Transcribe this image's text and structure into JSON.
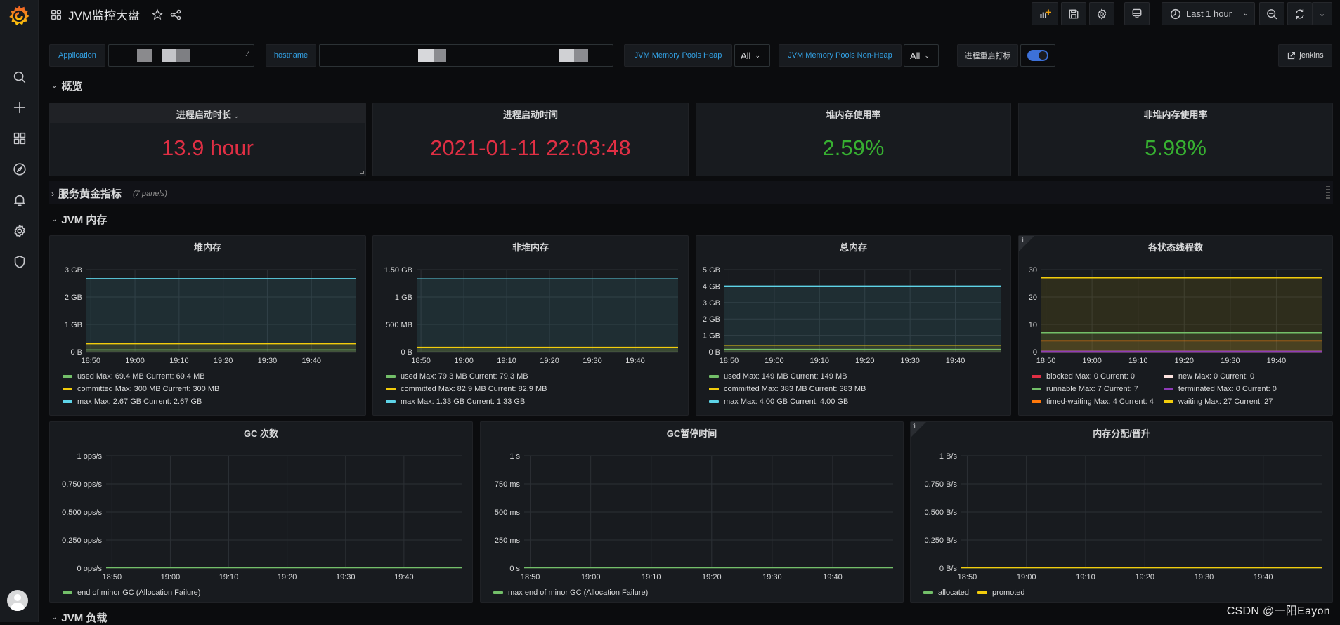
{
  "topbar": {
    "title": "JVM监控大盘",
    "time_range": "Last 1 hour",
    "icons": [
      "apps-icon",
      "star-icon",
      "share-icon",
      "add-panel-icon",
      "save-icon",
      "settings-icon",
      "tv-mode-icon",
      "clock-icon",
      "zoom-out-icon",
      "refresh-icon",
      "chevron-down-icon"
    ]
  },
  "sidebar": {
    "items": [
      "grafana-logo",
      "search",
      "create",
      "dashboards",
      "explore",
      "alerting",
      "configuration",
      "server-admin",
      "user-avatar"
    ]
  },
  "variables": {
    "application_label": "Application",
    "hostname_label": "hostname",
    "heap_pools_label": "JVM Memory Pools Heap",
    "heap_pools_value": "All",
    "nonheap_pools_label": "JVM Memory Pools Non-Heap",
    "nonheap_pools_value": "All",
    "restart_mark_label": "进程重启打标",
    "restart_mark_enabled": true,
    "link_label": "jenkins"
  },
  "rows": {
    "overview": "概览",
    "golden": "服务黄金指标",
    "golden_count": "(7 panels)",
    "jvm_memory": "JVM 内存",
    "jvm_load": "JVM 负载"
  },
  "stats": [
    {
      "title": "进程启动时长",
      "value": "13.9 hour",
      "color": "#e02f44"
    },
    {
      "title": "进程启动时间",
      "value": "2021-01-11 22:03:48",
      "color": "#e02f44"
    },
    {
      "title": "堆内存使用率",
      "value": "2.59%",
      "color": "#37b031"
    },
    {
      "title": "非堆内存使用率",
      "value": "5.98%",
      "color": "#37b031"
    }
  ],
  "watermark": "CSDN @一阳Eayon",
  "chart_data": [
    {
      "type": "area",
      "title": "堆内存",
      "x": [
        "18:50",
        "19:00",
        "19:10",
        "19:20",
        "19:30",
        "19:40"
      ],
      "yticks": [
        "0 B",
        "1 GB",
        "2 GB",
        "3 GB"
      ],
      "ylim": [
        0,
        3
      ],
      "yunit": "GB",
      "series": [
        {
          "name": "used",
          "value": 0.0678,
          "color": "#73bf69",
          "legend": "used  Max: 69.4 MB  Current: 69.4 MB"
        },
        {
          "name": "committed",
          "value": 0.293,
          "color": "#f2cc0c",
          "legend": "committed  Max: 300 MB  Current: 300 MB"
        },
        {
          "name": "max",
          "value": 2.67,
          "color": "#5ed4e8",
          "legend": "max  Max: 2.67 GB  Current: 2.67 GB"
        }
      ]
    },
    {
      "type": "area",
      "title": "非堆内存",
      "x": [
        "18:50",
        "19:00",
        "19:10",
        "19:20",
        "19:30",
        "19:40"
      ],
      "yticks": [
        "0 B",
        "500 MB",
        "1 GB",
        "1.50 GB"
      ],
      "ylim": [
        0,
        1.5
      ],
      "yunit": "GB",
      "series": [
        {
          "name": "used",
          "value": 0.0774,
          "color": "#73bf69",
          "legend": "used  Max: 79.3 MB  Current: 79.3 MB"
        },
        {
          "name": "committed",
          "value": 0.081,
          "color": "#f2cc0c",
          "legend": "committed  Max: 82.9 MB  Current: 82.9 MB"
        },
        {
          "name": "max",
          "value": 1.33,
          "color": "#5ed4e8",
          "legend": "max  Max: 1.33 GB  Current: 1.33 GB"
        }
      ]
    },
    {
      "type": "area",
      "title": "总内存",
      "x": [
        "18:50",
        "19:00",
        "19:10",
        "19:20",
        "19:30",
        "19:40"
      ],
      "yticks": [
        "0 B",
        "1 GB",
        "2 GB",
        "3 GB",
        "4 GB",
        "5 GB"
      ],
      "ylim": [
        0,
        5
      ],
      "yunit": "GB",
      "series": [
        {
          "name": "used",
          "value": 0.1455,
          "color": "#73bf69",
          "legend": "used  Max: 149 MB  Current: 149 MB"
        },
        {
          "name": "committed",
          "value": 0.374,
          "color": "#f2cc0c",
          "legend": "committed  Max: 383 MB  Current: 383 MB"
        },
        {
          "name": "max",
          "value": 4.0,
          "color": "#5ed4e8",
          "legend": "max  Max: 4.00 GB  Current: 4.00 GB"
        }
      ]
    },
    {
      "type": "area",
      "title": "各状态线程数",
      "info": true,
      "x": [
        "18:50",
        "19:00",
        "19:10",
        "19:20",
        "19:30",
        "19:40"
      ],
      "yticks": [
        "0",
        "10",
        "20",
        "30"
      ],
      "ylim": [
        0,
        30
      ],
      "yunit": "",
      "legend_cols": 2,
      "series": [
        {
          "name": "blocked",
          "value": 0,
          "color": "#e02f44",
          "legend": "blocked  Max: 0  Current: 0"
        },
        {
          "name": "new",
          "value": 0,
          "color": "#fce2de",
          "legend": "new  Max: 0  Current: 0"
        },
        {
          "name": "runnable",
          "value": 7,
          "color": "#73bf69",
          "legend": "runnable  Max: 7  Current: 7"
        },
        {
          "name": "terminated",
          "value": 0,
          "color": "#8f3bb8",
          "legend": "terminated  Max: 0  Current: 0"
        },
        {
          "name": "timed-waiting",
          "value": 4,
          "color": "#ff780a",
          "legend": "timed-waiting  Max: 4  Current: 4"
        },
        {
          "name": "waiting",
          "value": 27,
          "color": "#f2cc0c",
          "legend": "waiting  Max: 27  Current: 27"
        }
      ]
    },
    {
      "type": "line",
      "title": "GC 次数",
      "x": [
        "18:50",
        "19:00",
        "19:10",
        "19:20",
        "19:30",
        "19:40"
      ],
      "yticks": [
        "0 ops/s",
        "0.250 ops/s",
        "0.500 ops/s",
        "0.750 ops/s",
        "1 ops/s"
      ],
      "ylim": [
        0,
        1
      ],
      "series": [
        {
          "name": "end of minor GC (Allocation Failure)",
          "value": 0,
          "color": "#73bf69",
          "legend": "end of minor GC (Allocation Failure)"
        }
      ]
    },
    {
      "type": "line",
      "title": "GC暂停时间",
      "x": [
        "18:50",
        "19:00",
        "19:10",
        "19:20",
        "19:30",
        "19:40"
      ],
      "yticks": [
        "0 s",
        "250 ms",
        "500 ms",
        "750 ms",
        "1 s"
      ],
      "ylim": [
        0,
        1
      ],
      "series": [
        {
          "name": "max end of minor GC (Allocation Failure)",
          "value": 0,
          "color": "#73bf69",
          "legend": "max end of minor GC (Allocation Failure)"
        }
      ]
    },
    {
      "type": "line",
      "title": "内存分配/晋升",
      "info": true,
      "x": [
        "18:50",
        "19:00",
        "19:10",
        "19:20",
        "19:30",
        "19:40"
      ],
      "yticks": [
        "0 B/s",
        "0.250 B/s",
        "0.500 B/s",
        "0.750 B/s",
        "1 B/s"
      ],
      "ylim": [
        0,
        1
      ],
      "legend_inline": true,
      "series": [
        {
          "name": "allocated",
          "value": 0,
          "color": "#73bf69",
          "legend": "allocated"
        },
        {
          "name": "promoted",
          "value": 0,
          "color": "#f2cc0c",
          "legend": "promoted"
        }
      ]
    }
  ]
}
